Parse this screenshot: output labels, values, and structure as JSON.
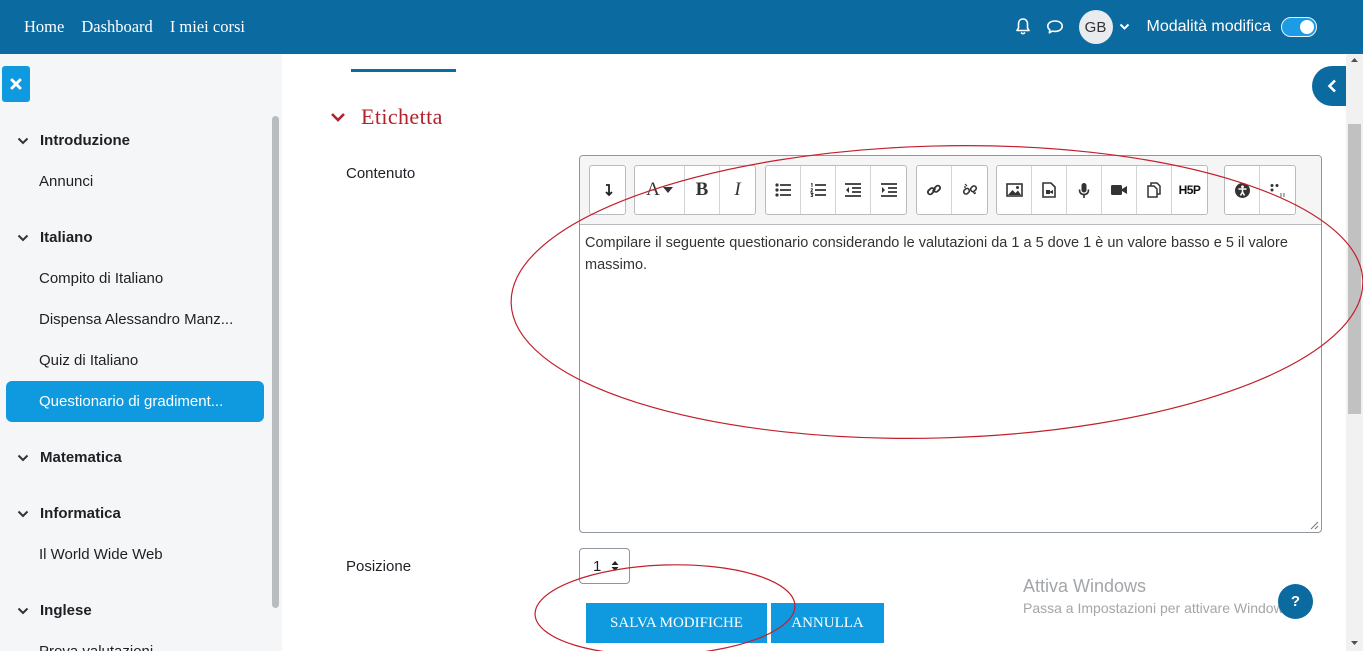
{
  "navbar": {
    "links": [
      "Home",
      "Dashboard",
      "I miei corsi"
    ],
    "avatar_initials": "GB",
    "edit_mode_label": "Modalità modifica",
    "edit_mode_on": true
  },
  "sidebar": {
    "sections": [
      {
        "title": "Introduzione",
        "items": [
          "Annunci"
        ]
      },
      {
        "title": "Italiano",
        "items": [
          "Compito di Italiano",
          "Dispensa Alessandro Manz...",
          "Quiz di Italiano",
          "Questionario di gradiment..."
        ]
      },
      {
        "title": "Matematica",
        "items": []
      },
      {
        "title": "Informatica",
        "items": [
          "Il World Wide Web"
        ]
      },
      {
        "title": "Inglese",
        "items": [
          "Prova valutazioni"
        ]
      }
    ],
    "active_item": "Questionario di gradiment..."
  },
  "main": {
    "section_title": "Etichetta",
    "content_label": "Contenuto",
    "editor_text": "Compilare il seguente questionario considerando le valutazioni da 1 a 5 dove 1 è un valore basso e 5 il valore massimo.",
    "position_label": "Posizione",
    "position_value": "1",
    "save_button": "SALVA MODIFICHE",
    "cancel_button": "ANNULLA"
  },
  "toolbar_icons": [
    "arrow-icon",
    "font-color-icon",
    "bold-icon",
    "italic-icon",
    "unordered-list-icon",
    "ordered-list-icon",
    "outdent-icon",
    "indent-icon",
    "link-icon",
    "unlink-icon",
    "image-icon",
    "media-icon",
    "record-audio-icon",
    "record-video-icon",
    "manage-files-icon",
    "h5p-icon",
    "accessibility-icon",
    "screenreader-helper-icon"
  ],
  "toolbar_labels": {
    "bold": "B",
    "italic": "I",
    "font": "A",
    "h5p": "H5P"
  },
  "watermark": {
    "title": "Attiva Windows",
    "subtitle": "Passa a Impostazioni per attivare Windows."
  },
  "help_label": "?",
  "colors": {
    "navbar": "#0b6a9f",
    "primary_button": "#0f9ae0",
    "section_title": "#b3212b",
    "annotation": "#c2202d"
  }
}
